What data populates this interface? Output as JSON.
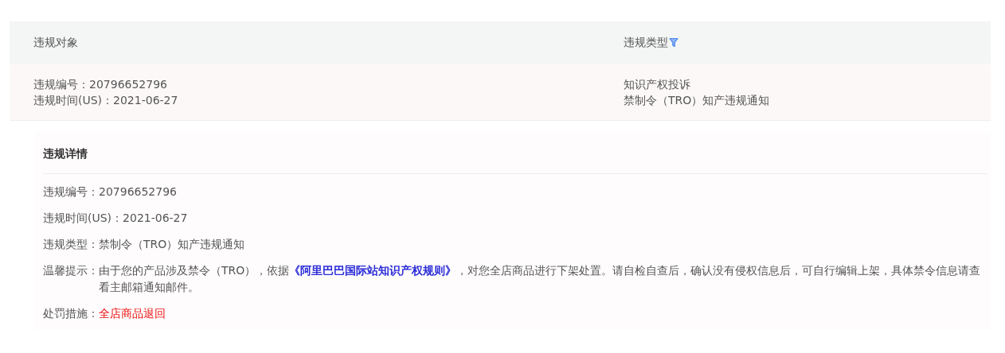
{
  "table": {
    "columns": [
      {
        "label": "违规对象",
        "filter": false
      },
      {
        "label": "违规类型",
        "filter": true
      }
    ],
    "rows": [
      {
        "object": [
          "违规编号：20796652796",
          "违规时间(US)：2021-06-27"
        ],
        "type": [
          "知识产权投诉",
          "禁制令（TRO）知产违规通知"
        ]
      }
    ]
  },
  "detail": {
    "title": "违规详情",
    "fields": [
      {
        "kind": "plain",
        "label": "违规编号：",
        "value": "20796652796"
      },
      {
        "kind": "plain",
        "label": "违规时间(US)：",
        "value": "2021-06-27"
      },
      {
        "kind": "plain",
        "label": "违规类型：",
        "value": "禁制令（TRO）知产违规通知"
      },
      {
        "kind": "notice",
        "label": "温馨提示：",
        "before": "由于您的产品涉及禁令（TRO），依据",
        "link": "《阿里巴巴国际站知识产权规则》",
        "after": "，对您全店商品进行下架处置。请自检自查后，确认没有侵权信息后，可自行编辑上架，具体禁令信息请查看主邮箱通知邮件。"
      },
      {
        "kind": "penalty",
        "label": "处罚措施：",
        "value": "全店商品退回"
      }
    ]
  }
}
